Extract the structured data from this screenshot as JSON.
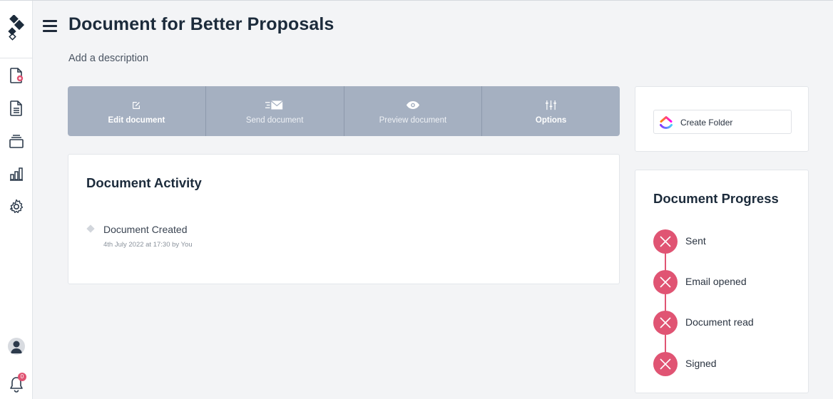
{
  "header": {
    "title": "Document for Better Proposals",
    "description_placeholder": "Add a description"
  },
  "toolbar": {
    "items": [
      {
        "label": "Edit document",
        "icon": "edit-icon"
      },
      {
        "label": "Send document",
        "icon": "send-mail-icon"
      },
      {
        "label": "Preview document",
        "icon": "eye-icon"
      },
      {
        "label": "Options",
        "icon": "sliders-icon"
      }
    ]
  },
  "activity": {
    "title": "Document Activity",
    "items": [
      {
        "title": "Document Created",
        "meta": "4th July 2022 at 17:30 by You"
      }
    ]
  },
  "folder": {
    "button_label": "Create Folder",
    "icon": "clickup-logo-icon"
  },
  "progress": {
    "title": "Document Progress",
    "steps": [
      {
        "label": "Sent",
        "status": "incomplete"
      },
      {
        "label": "Email opened",
        "status": "incomplete"
      },
      {
        "label": "Document read",
        "status": "incomplete"
      },
      {
        "label": "Signed",
        "status": "incomplete"
      }
    ]
  },
  "sidebar": {
    "items": [
      {
        "icon": "new-document-icon"
      },
      {
        "icon": "documents-icon"
      },
      {
        "icon": "templates-stack-icon"
      },
      {
        "icon": "analytics-icon"
      },
      {
        "icon": "settings-gear-icon"
      }
    ],
    "notification_count": "0"
  },
  "colors": {
    "accent_red": "#e05473",
    "toolbar_bg": "#a5b0c1",
    "title_text": "#1c2b3b"
  }
}
